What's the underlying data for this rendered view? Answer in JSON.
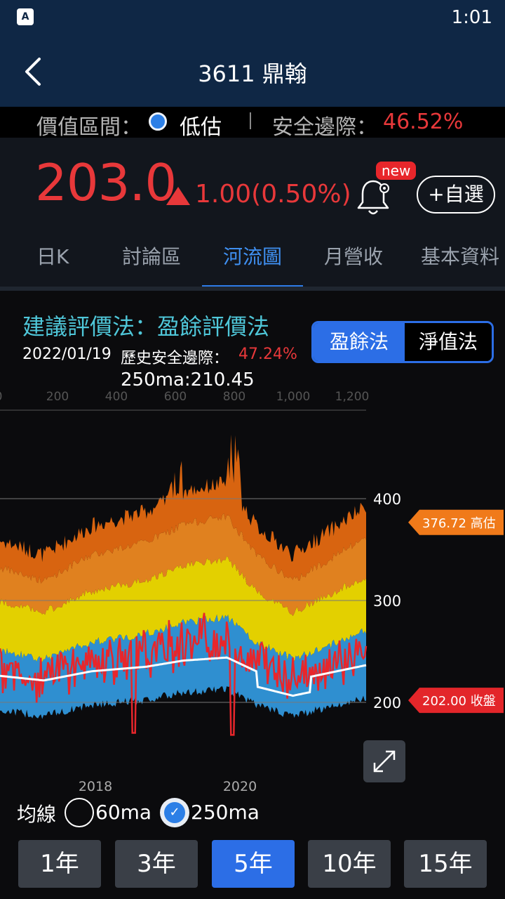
{
  "status": {
    "time": "1:01",
    "app_icon": "A"
  },
  "header": {
    "title": "3611 鼎翰",
    "back_icon": "back-arrow-icon"
  },
  "valuation": {
    "zone_label": "價值區間：",
    "zone_status": "低估",
    "safety_margin_label": "安全邊際：",
    "safety_margin_value": "46.52%"
  },
  "quote": {
    "price": "203.0",
    "change": "1.00(0.50%)",
    "new_badge": "new",
    "favorite_label": "+自選"
  },
  "tabs": [
    {
      "label": "日K"
    },
    {
      "label": "討論區"
    },
    {
      "label": "河流圖"
    },
    {
      "label": "月營收"
    },
    {
      "label": "基本資料"
    }
  ],
  "method": {
    "title": "建議評價法：盈餘評價法",
    "options": [
      "盈餘法",
      "淨值法"
    ],
    "date": "2022/01/19",
    "hist_margin_label": "歷史安全邊際：",
    "hist_margin_value": "47.24%",
    "ma_text": "250ma:210.45"
  },
  "chart_data": {
    "type": "area",
    "top_axis_ticks": [
      "0",
      "200",
      "400",
      "600",
      "800",
      "1,000",
      "1,200"
    ],
    "y_ticks": [
      "400",
      "300",
      "200"
    ],
    "ylim": [
      140,
      470
    ],
    "x_ticks": [
      "2018",
      "2020"
    ],
    "high_tag": "376.72 高估",
    "close_tag": "202.00 收盤",
    "colors": {
      "band1": "#2f8fd0",
      "band2": "#e3d000",
      "band3": "#e0811f",
      "band4": "#d86410",
      "price": "#e8262b",
      "ma": "#ffffff"
    }
  },
  "averages": {
    "label": "均線",
    "ma60": "60ma",
    "ma250": "250ma"
  },
  "periods": [
    {
      "label": "1年"
    },
    {
      "label": "3年"
    },
    {
      "label": "5年",
      "active": true
    },
    {
      "label": "10年"
    },
    {
      "label": "15年"
    }
  ]
}
